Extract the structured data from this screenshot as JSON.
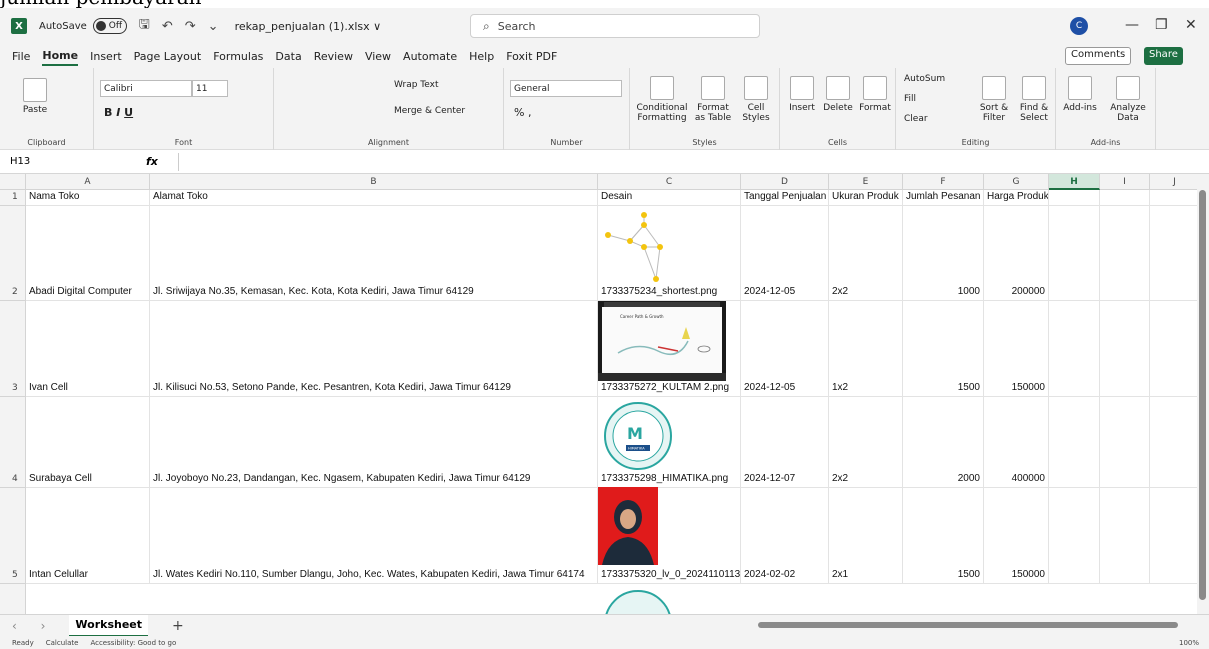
{
  "topclip_text": "jumlah pembayaran",
  "titlebar": {
    "autosave_label": "AutoSave",
    "toggle_label": "Off",
    "filename": "rekap_penjualan (1).xlsx ∨",
    "search_placeholder": "Search",
    "avatar_letter": "C"
  },
  "menu": {
    "items": [
      "File",
      "Home",
      "Insert",
      "Page Layout",
      "Formulas",
      "Data",
      "Review",
      "View",
      "Automate",
      "Help",
      "Foxit PDF"
    ],
    "comments": "Comments",
    "share": "Share"
  },
  "ribbon": {
    "clipboard": {
      "label": "Clipboard",
      "paste": "Paste"
    },
    "font": {
      "label": "Font",
      "font_name": "Calibri",
      "font_size": "11"
    },
    "alignment": {
      "label": "Alignment",
      "wrap": "Wrap Text",
      "merge": "Merge & Center"
    },
    "number": {
      "label": "Number",
      "format": "General"
    },
    "styles": {
      "label": "Styles",
      "cond": "Conditional Formatting",
      "table": "Format as Table",
      "cell": "Cell Styles"
    },
    "cells": {
      "label": "Cells",
      "insert": "Insert",
      "delete": "Delete",
      "format": "Format"
    },
    "editing": {
      "label": "Editing",
      "autosum": "AutoSum",
      "fill": "Fill",
      "clear": "Clear",
      "sort": "Sort & Filter",
      "find": "Find & Select"
    },
    "addins": {
      "label": "Add-ins",
      "addins": "Add-ins",
      "analyze": "Analyze Data"
    }
  },
  "formula_bar": {
    "name_box": "H13",
    "fx": "fx",
    "value": ""
  },
  "columns": [
    "A",
    "B",
    "C",
    "D",
    "E",
    "F",
    "G",
    "H",
    "I",
    "J"
  ],
  "rows": [
    {
      "num": "1",
      "a": "Nama Toko",
      "b": "Alamat Toko",
      "c": "Desain",
      "d": "Tanggal Penjualan",
      "e": "Ukuran Produk",
      "f": "Jumlah Pesanan",
      "g": "Harga Produk"
    },
    {
      "num": "2",
      "a": "Abadi Digital Computer",
      "b": "Jl. Sriwijaya No.35, Kemasan, Kec. Kota, Kota Kediri, Jawa Timur 64129",
      "c": "1733375234_shortest.png",
      "d": "2024-12-05",
      "e": "2x2",
      "f": "1000",
      "g": "200000"
    },
    {
      "num": "3",
      "a": "Ivan Cell",
      "b": "Jl. Kilisuci No.53, Setono Pande, Kec. Pesantren, Kota Kediri, Jawa Timur 64129",
      "c": "1733375272_KULTAM 2.png",
      "d": "2024-12-05",
      "e": "1x2",
      "f": "1500",
      "g": "150000"
    },
    {
      "num": "4",
      "a": "Surabaya Cell",
      "b": "Jl. Joyoboyo No.23, Dandangan, Kec. Ngasem, Kabupaten Kediri, Jawa Timur 64129",
      "c": "1733375298_HIMATIKA.png",
      "d": "2024-12-07",
      "e": "2x2",
      "f": "2000",
      "g": "400000"
    },
    {
      "num": "5",
      "a": "Intan Celullar",
      "b": "Jl. Wates Kediri No.110, Sumber Dlangu, Joho, Kec. Wates, Kabupaten Kediri, Jawa Timur 64174",
      "c": "1733375320_lv_0_2024110113",
      "d": "2024-02-02",
      "e": "2x1",
      "f": "1500",
      "g": "150000"
    }
  ],
  "image_text": {
    "kultam_title": "Career Path & Growth",
    "himatika": "HIMATIKA"
  },
  "sheet": {
    "tab": "Worksheet",
    "add": "+"
  },
  "status": {
    "ready": "Ready",
    "calculate": "Calculate",
    "accessibility": "Accessibility: Good to go",
    "zoom": "100%"
  }
}
